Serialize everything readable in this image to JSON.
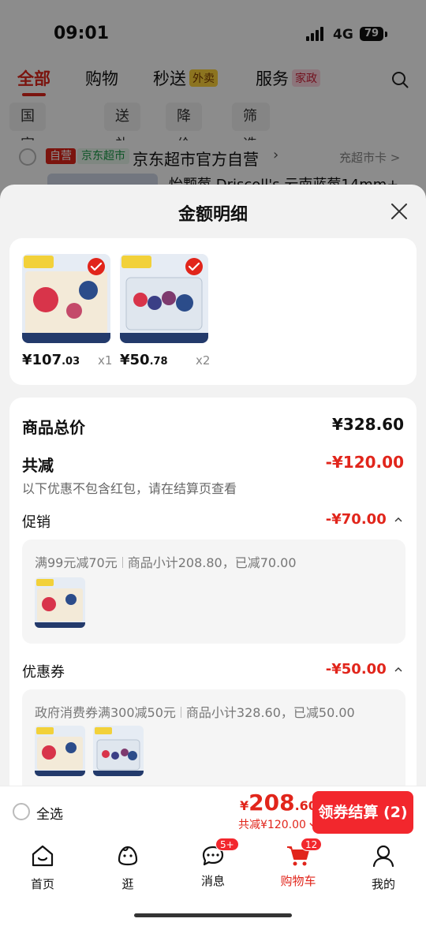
{
  "status": {
    "time": "09:01",
    "network": "4G",
    "battery": "79"
  },
  "top_tabs": [
    {
      "label": "全部"
    },
    {
      "label": "购物"
    },
    {
      "label": "秒送",
      "badge": "外卖"
    },
    {
      "label": "服务",
      "badge": "家政"
    }
  ],
  "chips": [
    "国家补贴",
    "送礼",
    "降价",
    "筛选"
  ],
  "store": {
    "self_badge": "自营",
    "mart_badge": "京东超市",
    "name": "京东超市官方自营",
    "right_text": "充超市卡 >",
    "item_title": "怡颗莓 Driscoll's 云南蓝莓14mm+"
  },
  "sheet": {
    "title": "金额明细",
    "products": [
      {
        "price_int": "¥107",
        "price_dec": ".03",
        "qty": "x1"
      },
      {
        "price_int": "¥50",
        "price_dec": ".78",
        "qty": "x2"
      }
    ],
    "goods_total_label": "商品总价",
    "goods_total_value": "¥328.60",
    "reduce_label": "共减",
    "reduce_value": "-¥120.00",
    "note": "以下优惠不包含红包，请在结算页查看",
    "promo": {
      "label": "促销",
      "value": "-¥70.00",
      "rule": "满99元减70元",
      "detail": "商品小计208.80，已减70.00"
    },
    "coupon": {
      "label": "优惠券",
      "value": "-¥50.00",
      "rule": "政府消费券满300减50元",
      "detail": "商品小计328.60，已减50.00"
    }
  },
  "checkout": {
    "select_all": "全选",
    "total_cur": "¥",
    "total_int": "208",
    "total_dec": ".60",
    "discount_text": "共减¥120.00",
    "button": "领券结算 (2)"
  },
  "tabbar": [
    {
      "label": "首页",
      "icon": "home-icon"
    },
    {
      "label": "逛",
      "icon": "browse-icon"
    },
    {
      "label": "消息",
      "icon": "message-icon",
      "badge": "5+"
    },
    {
      "label": "购物车",
      "icon": "cart-icon",
      "badge": "12"
    },
    {
      "label": "我的",
      "icon": "profile-icon"
    }
  ],
  "colors": {
    "accent": "#e1251b",
    "button": "#f2272d",
    "sheet_bg": "#f2f2f2"
  }
}
